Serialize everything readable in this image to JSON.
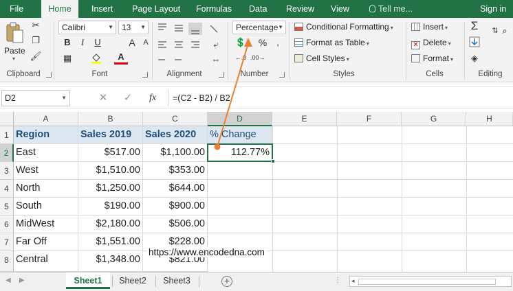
{
  "ribbon_tabs": [
    "File",
    "Home",
    "Insert",
    "Page Layout",
    "Formulas",
    "Data",
    "Review",
    "View"
  ],
  "tell_me": "Tell me...",
  "sign_in": "Sign in",
  "clipboard": {
    "paste": "Paste",
    "label": "Clipboard"
  },
  "font": {
    "name": "Calibri",
    "size": "13",
    "bold": "B",
    "italic": "I",
    "underline": "U",
    "grow": "A",
    "shrink": "A",
    "font_color": "A",
    "label": "Font"
  },
  "alignment": {
    "label": "Alignment"
  },
  "number": {
    "format": "Percentage",
    "percent": "%",
    "label": "Number"
  },
  "styles": {
    "conditional": "Conditional Formatting",
    "format_table": "Format as Table",
    "cell_styles": "Cell Styles",
    "label": "Styles"
  },
  "cells": {
    "insert": "Insert",
    "delete": "Delete",
    "format": "Format",
    "label": "Cells"
  },
  "editing": {
    "label": "Editing"
  },
  "formula_bar": {
    "name_box": "D2",
    "fx": "fx",
    "formula": "=(C2 - B2) / B2"
  },
  "columns": [
    "A",
    "B",
    "C",
    "D",
    "E",
    "F",
    "G",
    "H"
  ],
  "rows": [
    "1",
    "2",
    "3",
    "4",
    "5",
    "6",
    "7",
    "8"
  ],
  "table": {
    "headers": [
      "Region",
      "Sales 2019",
      "Sales 2020",
      "% Change"
    ],
    "rows": [
      [
        "East",
        "$517.00",
        "$1,100.00",
        "112.77%"
      ],
      [
        "West",
        "$1,510.00",
        "$353.00",
        ""
      ],
      [
        "North",
        "$1,250.00",
        "$644.00",
        ""
      ],
      [
        "South",
        "$190.00",
        "$900.00",
        ""
      ],
      [
        "MidWest",
        "$2,180.00",
        "$506.00",
        ""
      ],
      [
        "Far Off",
        "$1,551.00",
        "$228.00",
        ""
      ],
      [
        "Central",
        "$1,348.00",
        "$821.00",
        ""
      ]
    ]
  },
  "watermark": "https://www.encodedna.com",
  "sheets": [
    "Sheet1",
    "Sheet2",
    "Sheet3"
  ],
  "colors": {
    "excel_green": "#217346",
    "header_fill": "#dde7f1",
    "header_text": "#1f4e79",
    "arrow": "#ed7d31"
  }
}
